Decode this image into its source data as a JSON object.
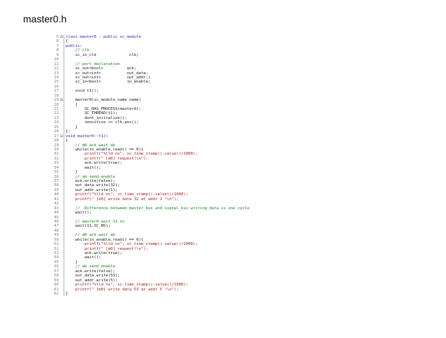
{
  "slide": {
    "title": "master0.h"
  },
  "code": {
    "lines": [
      {
        "n": "5",
        "m": "⊟",
        "t": "class master0 : public sc_module",
        "c": "kw"
      },
      {
        "n": "6",
        "m": "",
        "t": "{",
        "c": ""
      },
      {
        "n": "7",
        "m": "",
        "t": "public:",
        "c": "kw"
      },
      {
        "n": "8",
        "m": "",
        "t": "    // clk",
        "c": "cm"
      },
      {
        "n": "9",
        "m": "",
        "t": "    sc_in_clk              clk;",
        "c": ""
      },
      {
        "n": "10",
        "m": "",
        "t": "",
        "c": ""
      },
      {
        "n": "11",
        "m": "",
        "t": "    // port declaration",
        "c": "cm"
      },
      {
        "n": "12",
        "m": "",
        "t": "    sc_out<bool>          ack;",
        "c": ""
      },
      {
        "n": "13",
        "m": "",
        "t": "    sc_out<int>           out_data;",
        "c": ""
      },
      {
        "n": "14",
        "m": "",
        "t": "    sc_out<int>           out_addr;|",
        "c": ""
      },
      {
        "n": "15",
        "m": "",
        "t": "    sc_in<bool>           in_enable;",
        "c": ""
      },
      {
        "n": "16",
        "m": "",
        "t": "",
        "c": ""
      },
      {
        "n": "17",
        "m": "",
        "t": "    void t1();",
        "c": ""
      },
      {
        "n": "18",
        "m": "",
        "t": "",
        "c": ""
      },
      {
        "n": "19",
        "m": "⊟",
        "t": "    master0(sc_module_name name)",
        "c": ""
      },
      {
        "n": "20",
        "m": "",
        "t": "    {",
        "c": ""
      },
      {
        "n": "21",
        "m": "",
        "t": "        SC_HAS_PROCESS(master0);",
        "c": ""
      },
      {
        "n": "22",
        "m": "",
        "t": "        SC_THREAD(t1);",
        "c": ""
      },
      {
        "n": "23",
        "m": "",
        "t": "        dont_initialize();",
        "c": ""
      },
      {
        "n": "24",
        "m": "",
        "t": "        sensitive << clk.pos();",
        "c": ""
      },
      {
        "n": "25",
        "m": "",
        "t": "    }",
        "c": ""
      },
      {
        "n": "26",
        "m": "",
        "t": "};",
        "c": ""
      },
      {
        "n": "27",
        "m": "⊟",
        "t": "void master0::t1()",
        "c": "kw"
      },
      {
        "n": "28",
        "m": "",
        "t": "{",
        "c": ""
      },
      {
        "n": "29",
        "m": "",
        "t": "    // m0 ack wait ab",
        "c": "cm"
      },
      {
        "n": "30",
        "m": "",
        "t": "    while(in_enable.read() == 0){",
        "c": ""
      },
      {
        "n": "31",
        "m": "",
        "t": "        printf(\"%lld ns\", sc_time_stamp().value()/1000);",
        "c": "st"
      },
      {
        "n": "32",
        "m": "",
        "t": "        printf(\" [m0] request!\\n\");",
        "c": "st"
      },
      {
        "n": "33",
        "m": "",
        "t": "        ack.write(true);",
        "c": ""
      },
      {
        "n": "34",
        "m": "",
        "t": "        wait();",
        "c": ""
      },
      {
        "n": "35",
        "m": "",
        "t": "    }",
        "c": ""
      },
      {
        "n": "36",
        "m": "",
        "t": "    // ab send enable",
        "c": "cm"
      },
      {
        "n": "37",
        "m": "",
        "t": "    ack.write(false);",
        "c": ""
      },
      {
        "n": "38",
        "m": "",
        "t": "    out_data.write(32);",
        "c": ""
      },
      {
        "n": "39",
        "m": "",
        "t": "    out_addr.write(1);",
        "c": ""
      },
      {
        "n": "40",
        "m": "",
        "t": "    printf(\"%lld ns\", sc_time_stamp().value()/1000);",
        "c": "st"
      },
      {
        "n": "41",
        "m": "",
        "t": "    printf(\" [m0] write data 32 at addr 1 !\\n\");",
        "c": "st"
      },
      {
        "n": "42",
        "m": "",
        "t": "",
        "c": ""
      },
      {
        "n": "43",
        "m": "",
        "t": "    //  Difference between master_bus and signal_bus writing data is one cycle",
        "c": "cm"
      },
      {
        "n": "44",
        "m": "",
        "t": "    wait();",
        "c": ""
      },
      {
        "n": "45",
        "m": "",
        "t": "",
        "c": ""
      },
      {
        "n": "46",
        "m": "",
        "t": "    // master0 wait 11 ns",
        "c": "cm"
      },
      {
        "n": "47",
        "m": "",
        "t": "    wait(11,SC_NS);",
        "c": ""
      },
      {
        "n": "48",
        "m": "",
        "t": "",
        "c": ""
      },
      {
        "n": "49",
        "m": "",
        "t": "    // m0 ack wait ab",
        "c": "cm"
      },
      {
        "n": "50",
        "m": "",
        "t": "    while(in_enable.read() == 0){",
        "c": ""
      },
      {
        "n": "51",
        "m": "",
        "t": "        printf(\"%lld ns\", sc_time_stamp().value()/1000);",
        "c": "st"
      },
      {
        "n": "52",
        "m": "",
        "t": "        printf(\" [m0] request!\\n\");",
        "c": "st"
      },
      {
        "n": "53",
        "m": "",
        "t": "        ack.write(true);",
        "c": ""
      },
      {
        "n": "54",
        "m": "",
        "t": "        wait();",
        "c": ""
      },
      {
        "n": "55",
        "m": "",
        "t": "    }",
        "c": ""
      },
      {
        "n": "56",
        "m": "",
        "t": "    // ab send enable",
        "c": "cm"
      },
      {
        "n": "57",
        "m": "",
        "t": "    ack.write(false);",
        "c": ""
      },
      {
        "n": "58",
        "m": "",
        "t": "    out_data.write(53);",
        "c": ""
      },
      {
        "n": "59",
        "m": "",
        "t": "    out_addr.write(5);",
        "c": ""
      },
      {
        "n": "60",
        "m": "",
        "t": "    printf(\"%lld ns\", sc_time_stamp().value()/1000);",
        "c": "st"
      },
      {
        "n": "61",
        "m": "",
        "t": "    printf(\" [m0] write data 53 at addr 5 !\\n\");",
        "c": "st"
      },
      {
        "n": "62",
        "m": "",
        "t": "}",
        "c": ""
      }
    ]
  }
}
